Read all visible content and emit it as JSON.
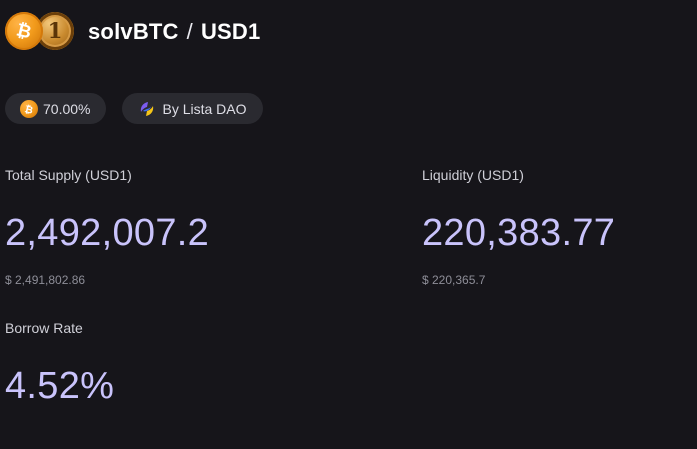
{
  "header": {
    "base_token": "solvBTC",
    "separator": "/",
    "quote_token": "USD1",
    "base_icon": "bitcoin-coin-icon",
    "quote_icon": "usd1-coin-icon"
  },
  "tags": {
    "ltv": "70.00%",
    "ltv_icon": "bitcoin-icon",
    "curator": "By Lista DAO",
    "curator_icon": "lista-dao-logo-icon"
  },
  "stats": {
    "total_supply": {
      "label": "Total Supply (USD1)",
      "value": "2,492,007.2",
      "usd": "$ 2,491,802.86"
    },
    "liquidity": {
      "label": "Liquidity (USD1)",
      "value": "220,383.77",
      "usd": "$ 220,365.7"
    },
    "borrow_rate": {
      "label": "Borrow Rate",
      "value": "4.52%"
    }
  },
  "colors": {
    "background": "#16151a",
    "accent_value": "#c9c3fb",
    "chip_background": "#2a2a30",
    "bitcoin_orange": "#f29b1c"
  }
}
